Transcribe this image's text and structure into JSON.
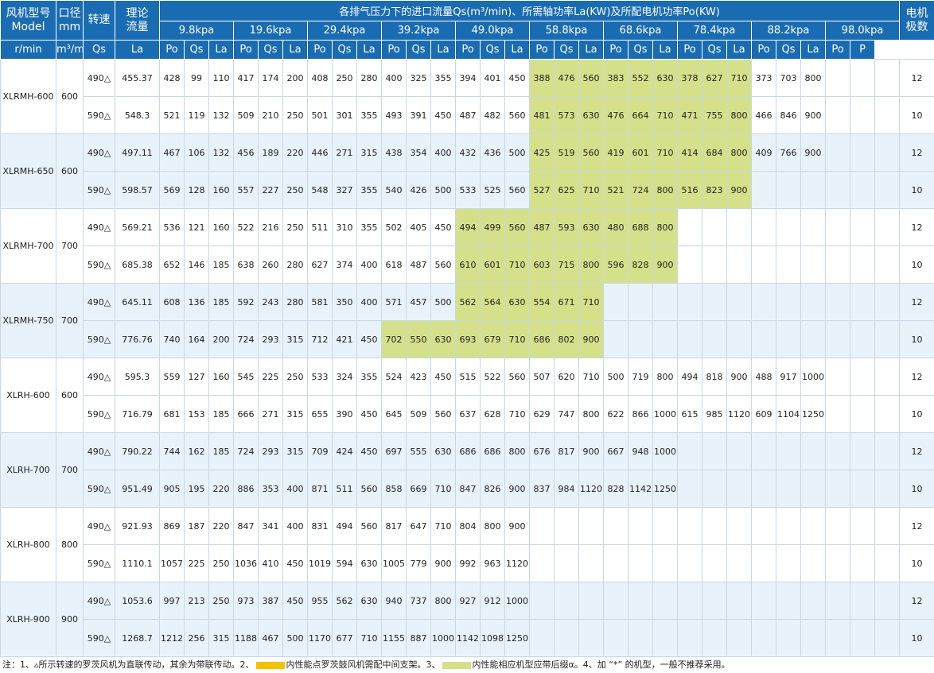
{
  "header": {
    "model_cn": "风机型号",
    "model_en": "Model",
    "bore_cn": "口径",
    "bore_unit": "mm",
    "speed_cn": "转速",
    "speed_unit": "r/min",
    "flow_cn1": "理论",
    "flow_cn2": "流量",
    "flow_unit": "m³/min",
    "title": "各排气压力下的进口流量Qs(m³/min)、所需轴功率La(KW)及所配电机功率Po(KW)",
    "motor_cn1": "电机",
    "motor_cn2": "极数",
    "motor_unit": "P",
    "pressures": [
      "9.8kpa",
      "19.6kpa",
      "29.4kpa",
      "39.2kpa",
      "49.0kpa",
      "58.8kpa",
      "68.6kpa",
      "78.4kpa",
      "88.2kpa",
      "98.0kpa"
    ],
    "sub": [
      "Qs",
      "La",
      "Po"
    ]
  },
  "highlight_colors": {
    "green": "#d5e18a",
    "yellow": "#f3c300",
    "header": "#1a6cb2"
  },
  "models": [
    {
      "name": "XLRMH-600",
      "bore": "600",
      "rows": [
        {
          "speed": "490△",
          "flow": "455.37",
          "vals": [
            "428",
            "99",
            "110",
            "417",
            "174",
            "200",
            "408",
            "250",
            "280",
            "400",
            "325",
            "355",
            "394",
            "401",
            "450",
            "388",
            "476",
            "560",
            "383",
            "552",
            "630",
            "378",
            "627",
            "710",
            "373",
            "703",
            "800",
            "",
            "",
            ""
          ],
          "green": [
            15,
            16,
            17,
            18,
            19,
            20,
            21,
            22,
            23
          ],
          "pole": "12"
        },
        {
          "speed": "590△",
          "flow": "548.3",
          "vals": [
            "521",
            "119",
            "132",
            "509",
            "210",
            "250",
            "501",
            "301",
            "355",
            "493",
            "391",
            "450",
            "487",
            "482",
            "560",
            "481",
            "573",
            "630",
            "476",
            "664",
            "710",
            "471",
            "755",
            "800",
            "466",
            "846",
            "900",
            "",
            "",
            ""
          ],
          "green": [
            15,
            16,
            17,
            18,
            19,
            20,
            21,
            22,
            23
          ],
          "pole": "10"
        }
      ]
    },
    {
      "name": "XLRMH-650",
      "bore": "600",
      "rows": [
        {
          "speed": "490△",
          "flow": "497.11",
          "vals": [
            "467",
            "106",
            "132",
            "456",
            "189",
            "220",
            "446",
            "271",
            "315",
            "438",
            "354",
            "400",
            "432",
            "436",
            "500",
            "425",
            "519",
            "560",
            "419",
            "601",
            "710",
            "414",
            "684",
            "800",
            "409",
            "766",
            "900",
            "",
            "",
            ""
          ],
          "green": [
            15,
            16,
            17,
            18,
            19,
            20,
            21,
            22,
            23
          ],
          "pole": "12"
        },
        {
          "speed": "590△",
          "flow": "598.57",
          "vals": [
            "569",
            "128",
            "160",
            "557",
            "227",
            "250",
            "548",
            "327",
            "355",
            "540",
            "426",
            "500",
            "533",
            "525",
            "560",
            "527",
            "625",
            "710",
            "521",
            "724",
            "800",
            "516",
            "823",
            "900",
            "",
            "",
            "",
            "",
            "",
            ""
          ],
          "green": [
            15,
            16,
            17,
            18,
            19,
            20,
            21,
            22,
            23
          ],
          "pole": "10"
        }
      ]
    },
    {
      "name": "XLRMH-700",
      "bore": "700",
      "rows": [
        {
          "speed": "490△",
          "flow": "569.21",
          "vals": [
            "536",
            "121",
            "160",
            "522",
            "216",
            "250",
            "511",
            "310",
            "355",
            "502",
            "405",
            "450",
            "494",
            "499",
            "560",
            "487",
            "593",
            "630",
            "480",
            "688",
            "800",
            "",
            "",
            "",
            "",
            "",
            "",
            "",
            "",
            ""
          ],
          "green": [
            12,
            13,
            14,
            15,
            16,
            17,
            18,
            19,
            20
          ],
          "pole": "12"
        },
        {
          "speed": "590△",
          "flow": "685.38",
          "vals": [
            "652",
            "146",
            "185",
            "638",
            "260",
            "280",
            "627",
            "374",
            "400",
            "618",
            "487",
            "560",
            "610",
            "601",
            "710",
            "603",
            "715",
            "800",
            "596",
            "828",
            "900",
            "",
            "",
            "",
            "",
            "",
            "",
            "",
            "",
            ""
          ],
          "green": [
            12,
            13,
            14,
            15,
            16,
            17,
            18,
            19,
            20
          ],
          "pole": "10"
        }
      ]
    },
    {
      "name": "XLRMH-750",
      "bore": "700",
      "rows": [
        {
          "speed": "490△",
          "flow": "645.11",
          "vals": [
            "608",
            "136",
            "185",
            "592",
            "243",
            "280",
            "581",
            "350",
            "400",
            "571",
            "457",
            "500",
            "562",
            "564",
            "630",
            "554",
            "671",
            "710",
            "",
            "",
            "",
            "",
            "",
            "",
            "",
            "",
            "",
            "",
            "",
            ""
          ],
          "green": [
            12,
            13,
            14,
            15,
            16,
            17
          ],
          "pole": "12"
        },
        {
          "speed": "590△",
          "flow": "776.76",
          "vals": [
            "740",
            "164",
            "200",
            "724",
            "293",
            "315",
            "712",
            "421",
            "450",
            "702",
            "550",
            "630",
            "693",
            "679",
            "710",
            "686",
            "802",
            "900",
            "",
            "",
            "",
            "",
            "",
            "",
            "",
            "",
            "",
            "",
            "",
            ""
          ],
          "green": [
            9,
            10,
            11,
            12,
            13,
            14,
            15,
            16,
            17
          ],
          "pole": "10"
        }
      ]
    },
    {
      "name": "XLRH-600",
      "bore": "600",
      "rows": [
        {
          "speed": "490△",
          "flow": "595.3",
          "vals": [
            "559",
            "127",
            "160",
            "545",
            "225",
            "250",
            "533",
            "324",
            "355",
            "524",
            "423",
            "450",
            "515",
            "522",
            "560",
            "507",
            "620",
            "710",
            "500",
            "719",
            "800",
            "494",
            "818",
            "900",
            "488",
            "917",
            "1000",
            "",
            "",
            ""
          ],
          "green": [],
          "pole": "12"
        },
        {
          "speed": "590△",
          "flow": "716.79",
          "vals": [
            "681",
            "153",
            "185",
            "666",
            "271",
            "315",
            "655",
            "390",
            "450",
            "645",
            "509",
            "560",
            "637",
            "628",
            "710",
            "629",
            "747",
            "800",
            "622",
            "866",
            "1000",
            "615",
            "985",
            "1120",
            "609",
            "1104",
            "1250",
            "",
            "",
            ""
          ],
          "green": [],
          "pole": "10"
        }
      ]
    },
    {
      "name": "XLRH-700",
      "bore": "700",
      "rows": [
        {
          "speed": "490△",
          "flow": "790.22",
          "vals": [
            "744",
            "162",
            "185",
            "724",
            "293",
            "315",
            "709",
            "424",
            "450",
            "697",
            "555",
            "630",
            "686",
            "686",
            "800",
            "676",
            "817",
            "900",
            "667",
            "948",
            "1000",
            "",
            "",
            "",
            "",
            "",
            "",
            "",
            "",
            ""
          ],
          "green": [],
          "pole": "12"
        },
        {
          "speed": "590△",
          "flow": "951.49",
          "vals": [
            "905",
            "195",
            "220",
            "886",
            "353",
            "400",
            "871",
            "511",
            "560",
            "858",
            "669",
            "710",
            "847",
            "826",
            "900",
            "837",
            "984",
            "1120",
            "828",
            "1142",
            "1250",
            "",
            "",
            "",
            "",
            "",
            "",
            "",
            "",
            ""
          ],
          "green": [],
          "pole": "10"
        }
      ]
    },
    {
      "name": "XLRH-800",
      "bore": "800",
      "rows": [
        {
          "speed": "490△",
          "flow": "921.93",
          "vals": [
            "869",
            "187",
            "220",
            "847",
            "341",
            "400",
            "831",
            "494",
            "560",
            "817",
            "647",
            "710",
            "804",
            "800",
            "900",
            "",
            "",
            "",
            "",
            "",
            "",
            "",
            "",
            "",
            "",
            "",
            "",
            "",
            "",
            ""
          ],
          "green": [],
          "pole": "12"
        },
        {
          "speed": "590△",
          "flow": "1110.1",
          "vals": [
            "1057",
            "225",
            "250",
            "1036",
            "410",
            "450",
            "1019",
            "594",
            "630",
            "1005",
            "779",
            "900",
            "992",
            "963",
            "1120",
            "",
            "",
            "",
            "",
            "",
            "",
            "",
            "",
            "",
            "",
            "",
            "",
            "",
            "",
            ""
          ],
          "green": [],
          "pole": "10"
        }
      ]
    },
    {
      "name": "XLRH-900",
      "bore": "900",
      "rows": [
        {
          "speed": "490△",
          "flow": "1053.6",
          "vals": [
            "997",
            "213",
            "250",
            "973",
            "387",
            "450",
            "955",
            "562",
            "630",
            "940",
            "737",
            "800",
            "927",
            "912",
            "1000",
            "",
            "",
            "",
            "",
            "",
            "",
            "",
            "",
            "",
            "",
            "",
            "",
            "",
            "",
            ""
          ],
          "green": [],
          "pole": "12"
        },
        {
          "speed": "590△",
          "flow": "1268.7",
          "vals": [
            "1212",
            "256",
            "315",
            "1188",
            "467",
            "500",
            "1170",
            "677",
            "710",
            "1155",
            "887",
            "1000",
            "1142",
            "1098",
            "1250",
            "",
            "",
            "",
            "",
            "",
            "",
            "",
            "",
            "",
            "",
            "",
            "",
            "",
            "",
            ""
          ],
          "green": [],
          "pole": "10"
        }
      ]
    }
  ],
  "note": {
    "part1": "注：1、▵所示转速的罗茨风机为直联传动，其余为带联传动。2、",
    "part2": "内性能点罗茨鼓风机需配中间支架。3、",
    "part3": "内性能相应机型应带后缀α。4、加 “*” 的机型，一般不推荐采用。"
  }
}
